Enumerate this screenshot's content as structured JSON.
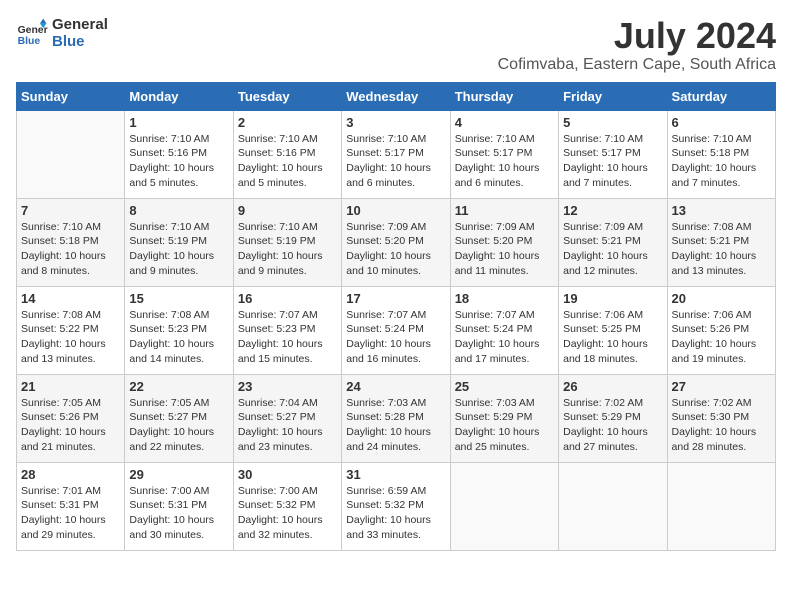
{
  "header": {
    "logo_line1": "General",
    "logo_line2": "Blue",
    "month": "July 2024",
    "location": "Cofimvaba, Eastern Cape, South Africa"
  },
  "weekdays": [
    "Sunday",
    "Monday",
    "Tuesday",
    "Wednesday",
    "Thursday",
    "Friday",
    "Saturday"
  ],
  "weeks": [
    [
      {
        "day": "",
        "sunrise": "",
        "sunset": "",
        "daylight": ""
      },
      {
        "day": "1",
        "sunrise": "Sunrise: 7:10 AM",
        "sunset": "Sunset: 5:16 PM",
        "daylight": "Daylight: 10 hours and 5 minutes."
      },
      {
        "day": "2",
        "sunrise": "Sunrise: 7:10 AM",
        "sunset": "Sunset: 5:16 PM",
        "daylight": "Daylight: 10 hours and 5 minutes."
      },
      {
        "day": "3",
        "sunrise": "Sunrise: 7:10 AM",
        "sunset": "Sunset: 5:17 PM",
        "daylight": "Daylight: 10 hours and 6 minutes."
      },
      {
        "day": "4",
        "sunrise": "Sunrise: 7:10 AM",
        "sunset": "Sunset: 5:17 PM",
        "daylight": "Daylight: 10 hours and 6 minutes."
      },
      {
        "day": "5",
        "sunrise": "Sunrise: 7:10 AM",
        "sunset": "Sunset: 5:17 PM",
        "daylight": "Daylight: 10 hours and 7 minutes."
      },
      {
        "day": "6",
        "sunrise": "Sunrise: 7:10 AM",
        "sunset": "Sunset: 5:18 PM",
        "daylight": "Daylight: 10 hours and 7 minutes."
      }
    ],
    [
      {
        "day": "7",
        "sunrise": "Sunrise: 7:10 AM",
        "sunset": "Sunset: 5:18 PM",
        "daylight": "Daylight: 10 hours and 8 minutes."
      },
      {
        "day": "8",
        "sunrise": "Sunrise: 7:10 AM",
        "sunset": "Sunset: 5:19 PM",
        "daylight": "Daylight: 10 hours and 9 minutes."
      },
      {
        "day": "9",
        "sunrise": "Sunrise: 7:10 AM",
        "sunset": "Sunset: 5:19 PM",
        "daylight": "Daylight: 10 hours and 9 minutes."
      },
      {
        "day": "10",
        "sunrise": "Sunrise: 7:09 AM",
        "sunset": "Sunset: 5:20 PM",
        "daylight": "Daylight: 10 hours and 10 minutes."
      },
      {
        "day": "11",
        "sunrise": "Sunrise: 7:09 AM",
        "sunset": "Sunset: 5:20 PM",
        "daylight": "Daylight: 10 hours and 11 minutes."
      },
      {
        "day": "12",
        "sunrise": "Sunrise: 7:09 AM",
        "sunset": "Sunset: 5:21 PM",
        "daylight": "Daylight: 10 hours and 12 minutes."
      },
      {
        "day": "13",
        "sunrise": "Sunrise: 7:08 AM",
        "sunset": "Sunset: 5:21 PM",
        "daylight": "Daylight: 10 hours and 13 minutes."
      }
    ],
    [
      {
        "day": "14",
        "sunrise": "Sunrise: 7:08 AM",
        "sunset": "Sunset: 5:22 PM",
        "daylight": "Daylight: 10 hours and 13 minutes."
      },
      {
        "day": "15",
        "sunrise": "Sunrise: 7:08 AM",
        "sunset": "Sunset: 5:23 PM",
        "daylight": "Daylight: 10 hours and 14 minutes."
      },
      {
        "day": "16",
        "sunrise": "Sunrise: 7:07 AM",
        "sunset": "Sunset: 5:23 PM",
        "daylight": "Daylight: 10 hours and 15 minutes."
      },
      {
        "day": "17",
        "sunrise": "Sunrise: 7:07 AM",
        "sunset": "Sunset: 5:24 PM",
        "daylight": "Daylight: 10 hours and 16 minutes."
      },
      {
        "day": "18",
        "sunrise": "Sunrise: 7:07 AM",
        "sunset": "Sunset: 5:24 PM",
        "daylight": "Daylight: 10 hours and 17 minutes."
      },
      {
        "day": "19",
        "sunrise": "Sunrise: 7:06 AM",
        "sunset": "Sunset: 5:25 PM",
        "daylight": "Daylight: 10 hours and 18 minutes."
      },
      {
        "day": "20",
        "sunrise": "Sunrise: 7:06 AM",
        "sunset": "Sunset: 5:26 PM",
        "daylight": "Daylight: 10 hours and 19 minutes."
      }
    ],
    [
      {
        "day": "21",
        "sunrise": "Sunrise: 7:05 AM",
        "sunset": "Sunset: 5:26 PM",
        "daylight": "Daylight: 10 hours and 21 minutes."
      },
      {
        "day": "22",
        "sunrise": "Sunrise: 7:05 AM",
        "sunset": "Sunset: 5:27 PM",
        "daylight": "Daylight: 10 hours and 22 minutes."
      },
      {
        "day": "23",
        "sunrise": "Sunrise: 7:04 AM",
        "sunset": "Sunset: 5:27 PM",
        "daylight": "Daylight: 10 hours and 23 minutes."
      },
      {
        "day": "24",
        "sunrise": "Sunrise: 7:03 AM",
        "sunset": "Sunset: 5:28 PM",
        "daylight": "Daylight: 10 hours and 24 minutes."
      },
      {
        "day": "25",
        "sunrise": "Sunrise: 7:03 AM",
        "sunset": "Sunset: 5:29 PM",
        "daylight": "Daylight: 10 hours and 25 minutes."
      },
      {
        "day": "26",
        "sunrise": "Sunrise: 7:02 AM",
        "sunset": "Sunset: 5:29 PM",
        "daylight": "Daylight: 10 hours and 27 minutes."
      },
      {
        "day": "27",
        "sunrise": "Sunrise: 7:02 AM",
        "sunset": "Sunset: 5:30 PM",
        "daylight": "Daylight: 10 hours and 28 minutes."
      }
    ],
    [
      {
        "day": "28",
        "sunrise": "Sunrise: 7:01 AM",
        "sunset": "Sunset: 5:31 PM",
        "daylight": "Daylight: 10 hours and 29 minutes."
      },
      {
        "day": "29",
        "sunrise": "Sunrise: 7:00 AM",
        "sunset": "Sunset: 5:31 PM",
        "daylight": "Daylight: 10 hours and 30 minutes."
      },
      {
        "day": "30",
        "sunrise": "Sunrise: 7:00 AM",
        "sunset": "Sunset: 5:32 PM",
        "daylight": "Daylight: 10 hours and 32 minutes."
      },
      {
        "day": "31",
        "sunrise": "Sunrise: 6:59 AM",
        "sunset": "Sunset: 5:32 PM",
        "daylight": "Daylight: 10 hours and 33 minutes."
      },
      {
        "day": "",
        "sunrise": "",
        "sunset": "",
        "daylight": ""
      },
      {
        "day": "",
        "sunrise": "",
        "sunset": "",
        "daylight": ""
      },
      {
        "day": "",
        "sunrise": "",
        "sunset": "",
        "daylight": ""
      }
    ]
  ]
}
